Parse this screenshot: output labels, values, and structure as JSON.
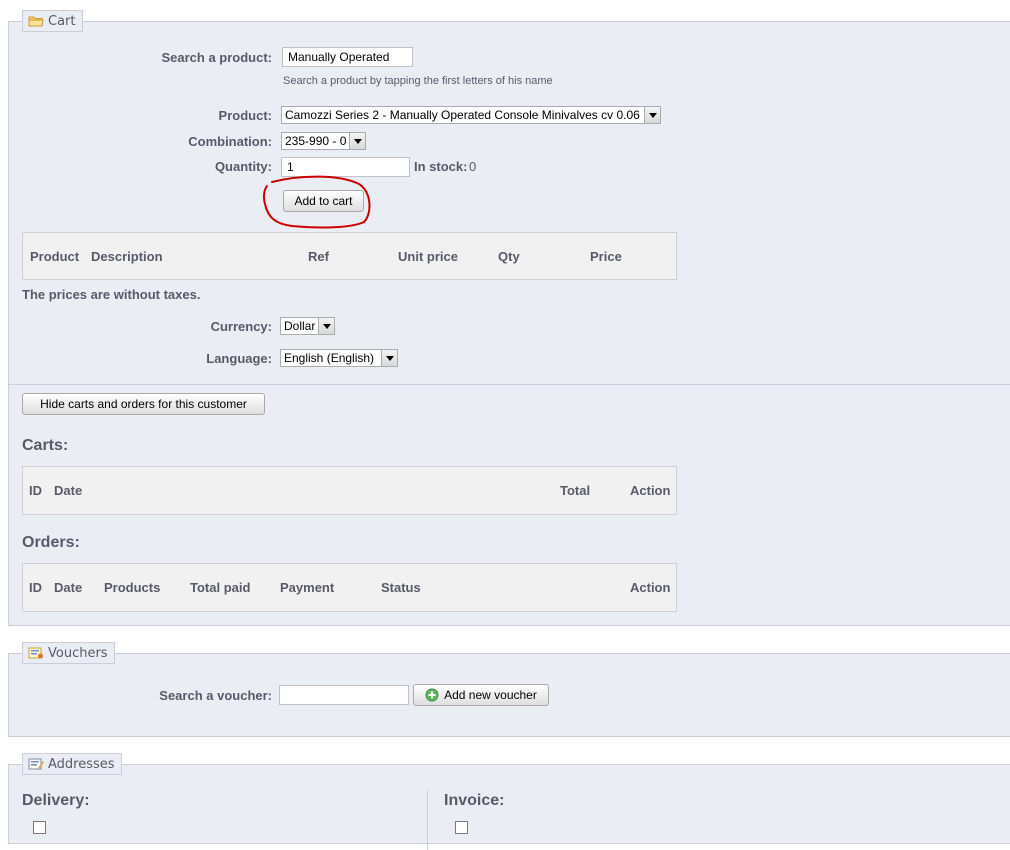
{
  "cart": {
    "legend": "Cart",
    "legend_icon": "folder-icon",
    "search_label": "Search a product:",
    "search_value": "Manually Operated",
    "search_help": "Search a product by tapping the first letters of his name",
    "product_label": "Product:",
    "product_value": "Camozzi Series 2 - Manually Operated Console Minivalves cv 0.06",
    "combination_label": "Combination:",
    "combination_value": "235-990 - 0",
    "quantity_label": "Quantity:",
    "quantity_value": "1",
    "in_stock_label": "In stock:",
    "in_stock_value": "0",
    "add_button": "Add to cart",
    "annotation_color": "#cc0000",
    "table_headers": [
      "Product",
      "Description",
      "Ref",
      "Unit price",
      "Qty",
      "Price"
    ],
    "prices_note": "The prices are without taxes.",
    "currency_label": "Currency:",
    "currency_value": "Dollar",
    "language_label": "Language:",
    "language_value": "English (English)",
    "hide_button": "Hide carts and orders for this customer",
    "carts_title": "Carts:",
    "carts_headers": [
      "ID",
      "Date",
      "Total",
      "Action"
    ],
    "orders_title": "Orders:",
    "orders_headers": [
      "ID",
      "Date",
      "Products",
      "Total paid",
      "Payment",
      "Status",
      "Action"
    ]
  },
  "vouchers": {
    "legend": "Vouchers",
    "legend_icon": "voucher-icon",
    "search_label": "Search a voucher:",
    "search_value": "",
    "add_button": "Add new voucher",
    "add_icon": "plus-icon"
  },
  "addresses": {
    "legend": "Addresses",
    "legend_icon": "address-icon",
    "delivery_title": "Delivery:",
    "invoice_title": "Invoice:"
  },
  "colors": {
    "panel_bg": "#ebedf4",
    "label_text": "#585a69",
    "table_header_bg": "#f1f1f1"
  }
}
